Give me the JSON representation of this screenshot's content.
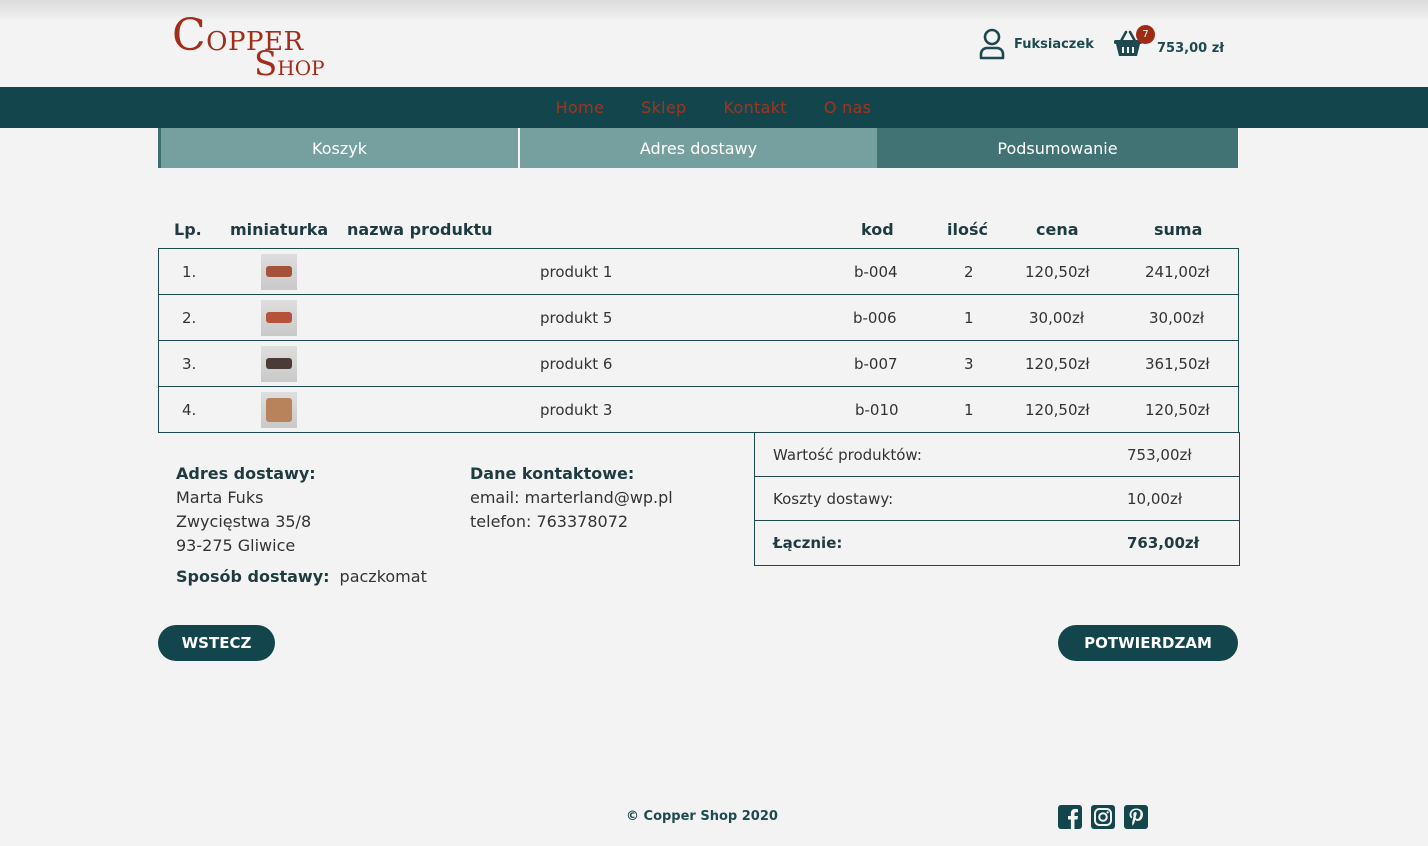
{
  "header": {
    "logo_word1_initial": "C",
    "logo_word1_rest": "OPPER",
    "logo_word2_initial": "S",
    "logo_word2_rest": "HOP",
    "username": "Fuksiaczek",
    "cart_count": "7",
    "cart_total": "753,00 zł"
  },
  "nav": {
    "items": [
      "Home",
      "Sklep",
      "Kontakt",
      "O nas"
    ],
    "color": "#a3341c"
  },
  "steps": [
    "Koszyk",
    "Adres dostawy",
    "Podsumowanie"
  ],
  "table": {
    "headers": [
      "Lp.",
      "miniaturka",
      "nazwa produktu",
      "kod",
      "ilość",
      "cena",
      "suma"
    ],
    "rows": [
      {
        "lp": "1.",
        "name": "produkt 1",
        "code": "b-004",
        "qty": "2",
        "price": "120,50zł",
        "sum": "241,00zł",
        "band_color": "#a5523a"
      },
      {
        "lp": "2.",
        "name": "produkt 5",
        "code": "b-006",
        "qty": "1",
        "price": "30,00zł",
        "sum": "30,00zł",
        "band_color": "#b5533a"
      },
      {
        "lp": "3.",
        "name": "produkt 6",
        "code": "b-007",
        "qty": "3",
        "price": "120,50zł",
        "sum": "361,50zł",
        "band_color": "#4a3a38"
      },
      {
        "lp": "4.",
        "name": "produkt 3",
        "code": "b-010",
        "qty": "1",
        "price": "120,50zł",
        "sum": "120,50zł",
        "band_color": "#b8835a"
      }
    ]
  },
  "address": {
    "title": "Adres dostawy:",
    "name": "Marta Fuks",
    "street": "Zwycięstwa 35/8",
    "city": "93-275 Gliwice"
  },
  "contact": {
    "title": "Dane kontaktowe:",
    "email": "email: marterland@wp.pl",
    "phone": "telefon: 763378072"
  },
  "shipping": {
    "title": "Sposób dostawy:",
    "value": "paczkomat"
  },
  "summary": {
    "products_label": "Wartość produktów:",
    "products_value": "753,00zł",
    "delivery_label": "Koszty dostawy:",
    "delivery_value": "10,00zł",
    "total_label": "Łącznie:",
    "total_value": "763,00zł"
  },
  "buttons": {
    "back": "WSTECZ",
    "confirm": "POTWIERDZAM"
  },
  "footer": {
    "copyright": "© Copper Shop 2020",
    "social_icons": [
      "facebook-icon",
      "instagram-icon",
      "pinterest-icon"
    ]
  }
}
